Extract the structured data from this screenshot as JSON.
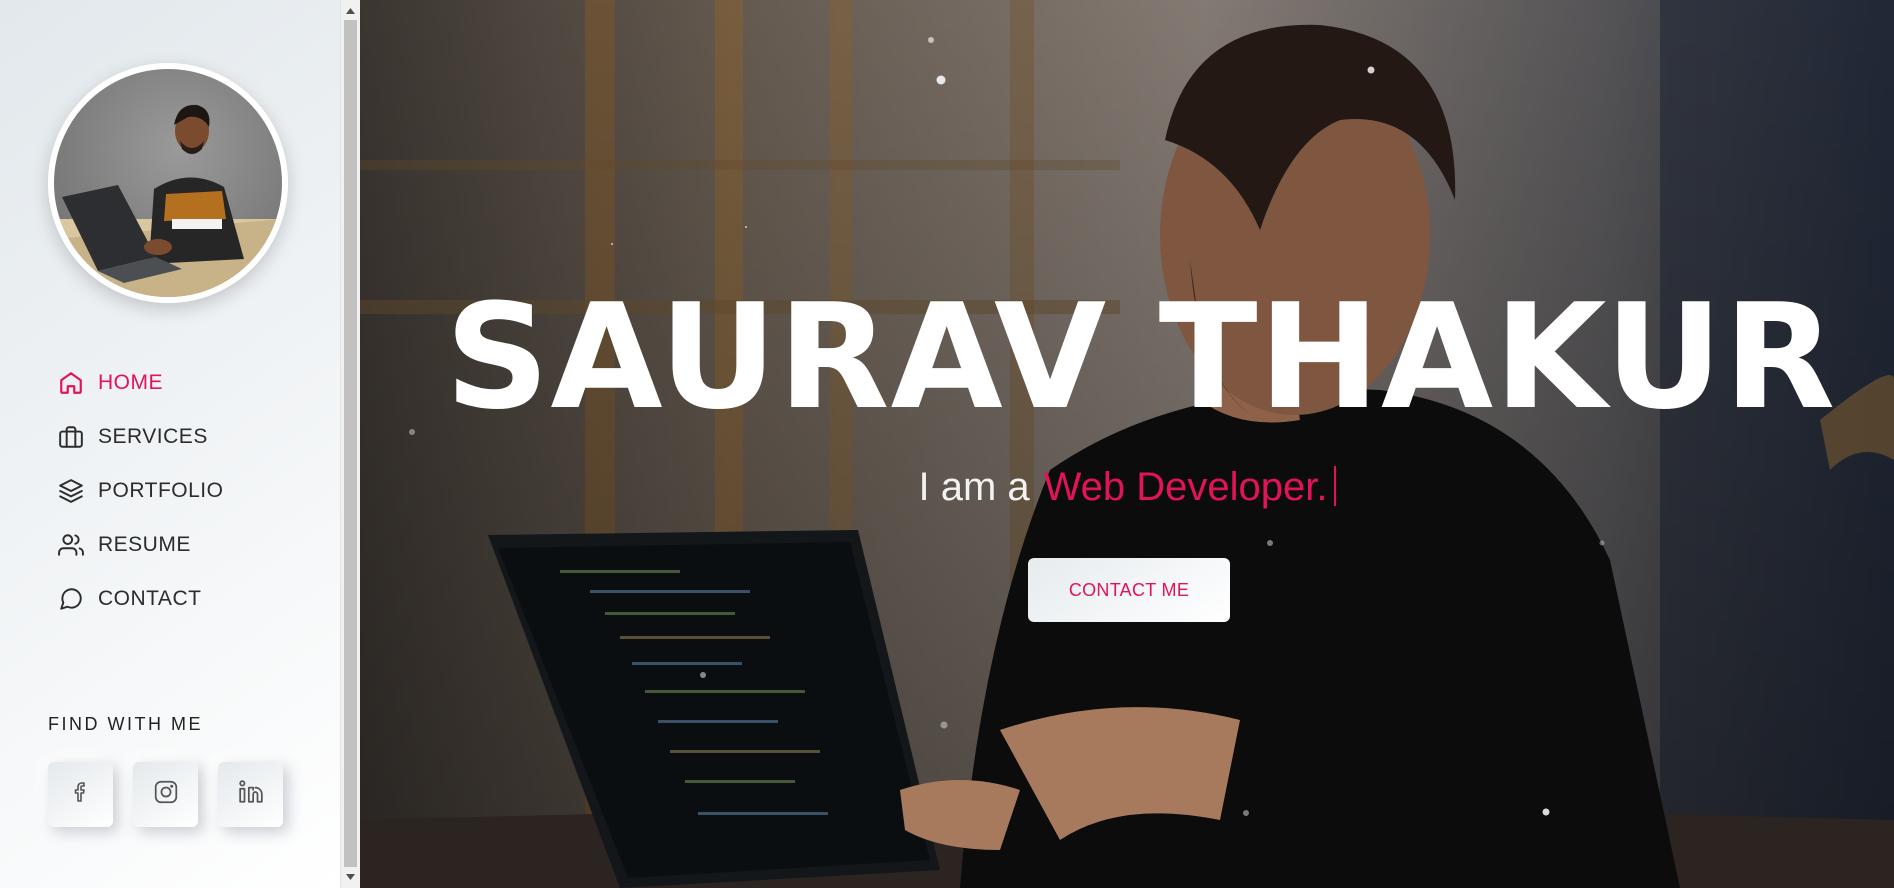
{
  "sidebar": {
    "nav": [
      {
        "label": "HOME",
        "icon": "home-icon",
        "active": true
      },
      {
        "label": "SERVICES",
        "icon": "briefcase-icon",
        "active": false
      },
      {
        "label": "PORTFOLIO",
        "icon": "layers-icon",
        "active": false
      },
      {
        "label": "RESUME",
        "icon": "users-icon",
        "active": false
      },
      {
        "label": "CONTACT",
        "icon": "message-circle-icon",
        "active": false
      }
    ],
    "find_title": "FIND WITH ME",
    "socials": [
      {
        "name": "facebook",
        "icon": "facebook-icon"
      },
      {
        "name": "instagram",
        "icon": "instagram-icon"
      },
      {
        "name": "linkedin",
        "icon": "linkedin-icon"
      }
    ]
  },
  "hero": {
    "title": "SAURAV THAKUR",
    "subtitle_prefix": "I am a",
    "subtitle_role": "Web Developer.",
    "cta_label": "CONTACT ME"
  },
  "colors": {
    "accent": "#e2135a",
    "sidebar_bg": "#eef2f5",
    "text_dark": "#2c2c2c"
  }
}
